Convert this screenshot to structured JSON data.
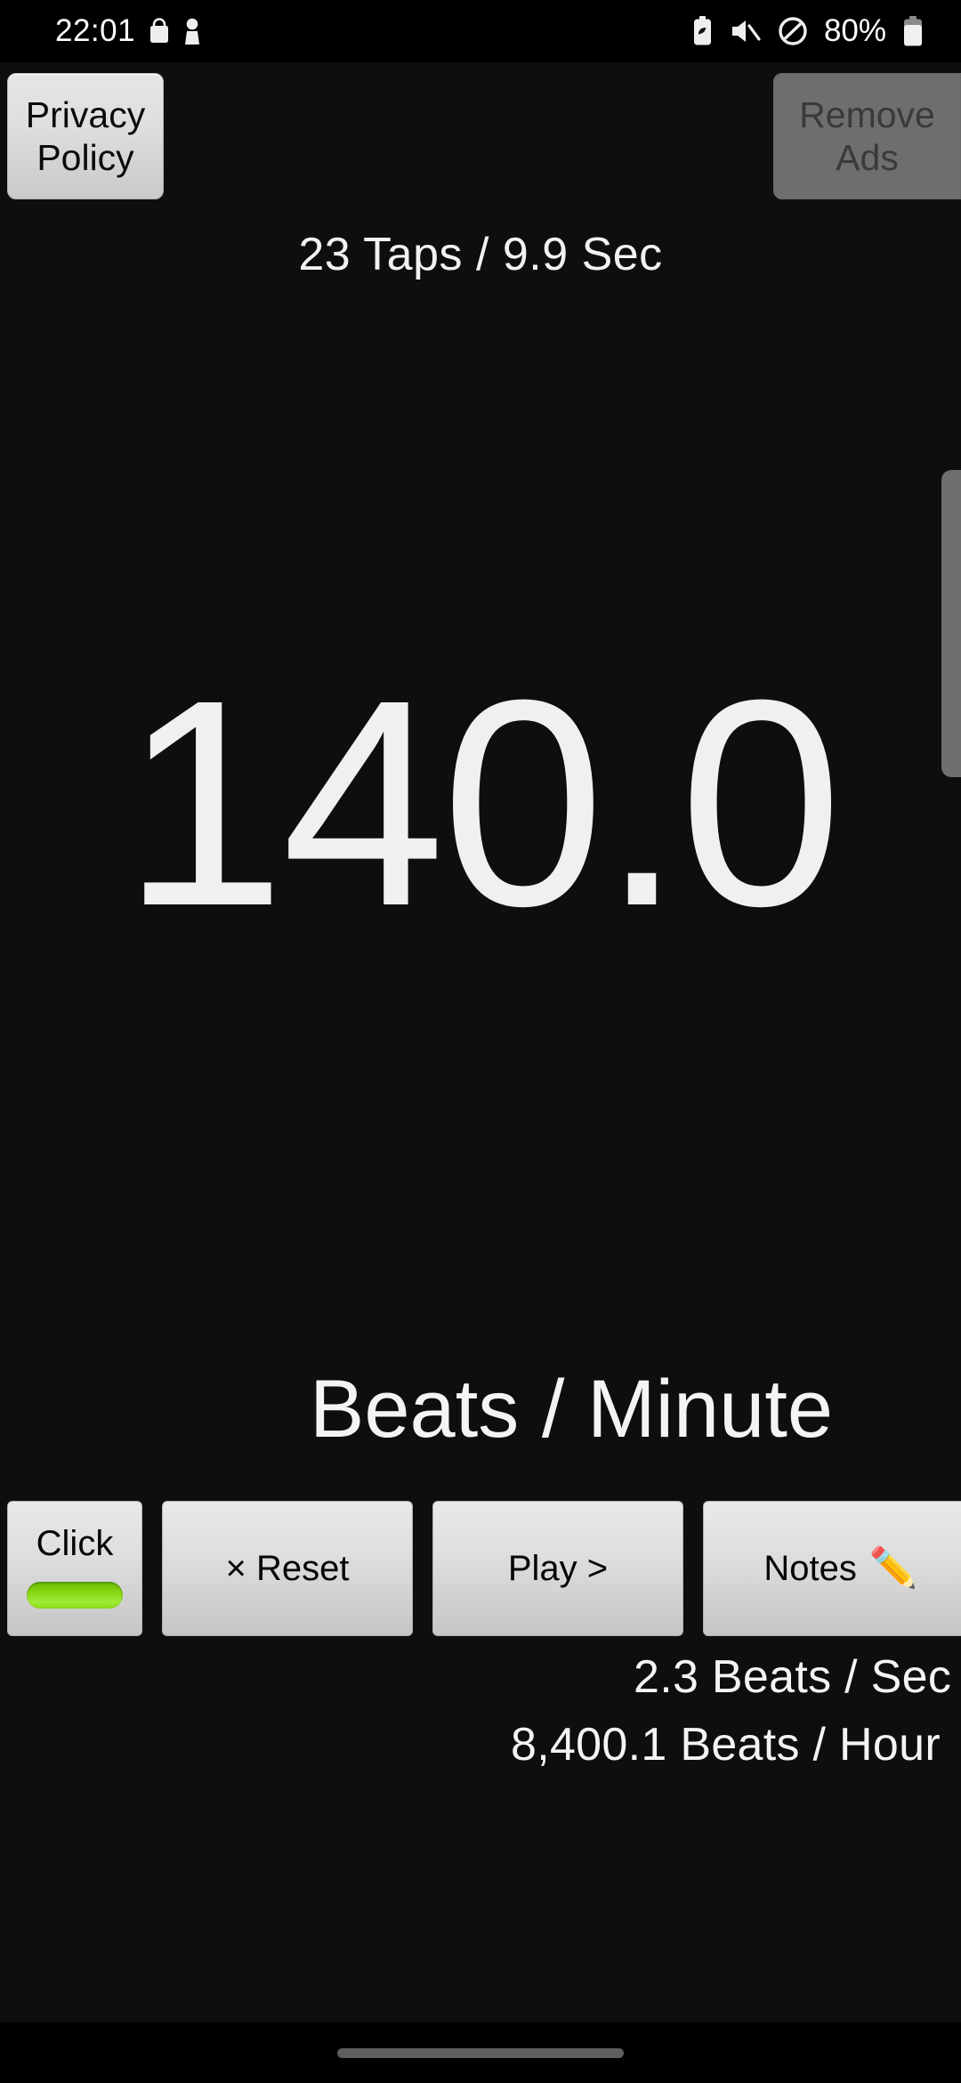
{
  "status_bar": {
    "clock": "22:01",
    "battery_percent": "80%",
    "left_icons": [
      "shopping-bag-icon",
      "person-icon"
    ],
    "right_icons": [
      "battery-saver-leaf-icon",
      "volume-mute-icon",
      "do-not-disturb-icon",
      "battery-icon"
    ]
  },
  "top_bar": {
    "privacy_label": "Privacy Policy",
    "remove_ads_label": "Remove Ads",
    "remove_ads_enabled": false
  },
  "header": {
    "taps_line": "23 Taps / 9.9 Sec"
  },
  "main": {
    "bpm_value": "140.0",
    "bpm_unit_label": "Beats / Minute"
  },
  "controls": {
    "click_label": "Click",
    "reset_label": "× Reset",
    "play_label": "Play >",
    "notes_label": "Notes",
    "notes_icon": "✏️"
  },
  "stats": {
    "beats_per_sec": "2.3 Beats / Sec",
    "beats_per_hour": "8,400.1 Beats / Hour"
  },
  "colors": {
    "background": "#0e0e0e",
    "text": "#f4f4f4",
    "button_face": "#dedede",
    "click_accent_green": "#86d410",
    "disabled_button": "#6e6e6e",
    "scrollbar": "#6f6f6f"
  }
}
